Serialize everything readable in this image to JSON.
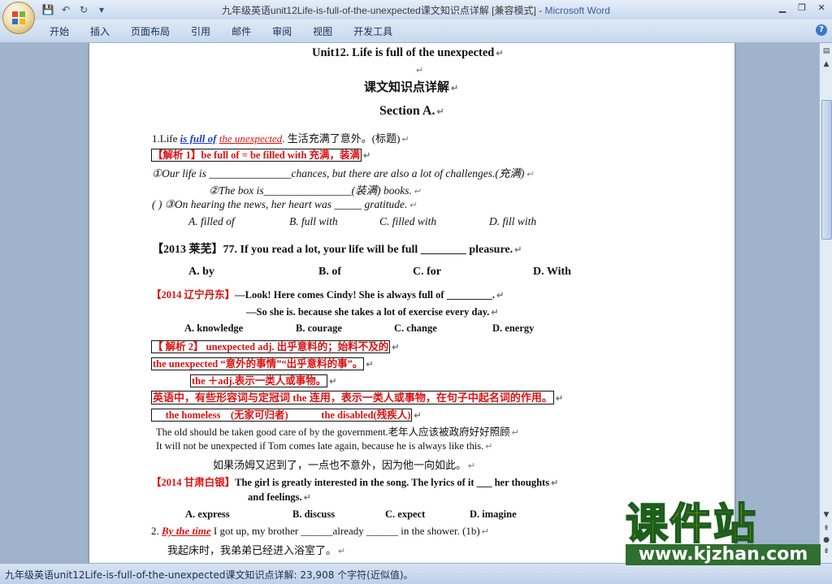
{
  "window": {
    "title_doc": "九年级英语unit12Life-is-full-of-the-unexpected课文知识点详解 [兼容模式] - ",
    "title_app": "Microsoft Word"
  },
  "tabs": [
    "开始",
    "插入",
    "页面布局",
    "引用",
    "邮件",
    "审阅",
    "视图",
    "开发工具"
  ],
  "icons": {
    "save": "save-icon",
    "undo": "undo-icon",
    "redo": "redo-icon",
    "customize": "dropdown-icon",
    "minimize": "minimize-icon",
    "maximize": "maximize-icon",
    "close": "close-icon",
    "help": "help-icon"
  },
  "doc": {
    "l01": "Unit12. Life is full of the unexpected",
    "l02": "课文知识点详解",
    "l03": "Section A.",
    "l04": {
      "pre": "1.Life ",
      "a": "is full of",
      "b": "the unexpected",
      "post": ". 生活充满了意外。(标题)"
    },
    "l05": "【解析 1】be full of = be filled with 充满，装满",
    "l06": "①Our life is _______________chances, but there are also a lot of challenges.(充满)",
    "l07": "②The box is________________(装满) books.",
    "l08": "(       )  ③On hearing the news, her heart was _____ gratitude.",
    "l09": [
      "A. filled  of",
      "B. full with",
      "C. filled    with",
      "D. fill with"
    ],
    "l10": "【2013 莱芜】77. If you read a lot, your life will be full ________ pleasure.",
    "l11": [
      "A. by",
      "B. of",
      "C. for",
      "D. With"
    ],
    "l12": {
      "tag": "【2014 辽宁丹东】",
      "text": "—Look! Here comes Cindy! She is always full of  _________."
    },
    "l13": "—So she is. because she takes a lot of exercise every day.",
    "l14": [
      "A. knowledge",
      "B. courage",
      "C. change",
      "D. energy"
    ],
    "l15": "【 解析 2】   unexpected    adj. 出乎意料的；始料不及的",
    "l16": "the unexpected    “意外的事情”“出乎意料的事”。",
    "l17": "the  ＋adj.表示一类人或事物。",
    "l18": "英语中，有些形容词与定冠词 the 连用，表示一类人或事物，在句子中起名词的作用。",
    "l19": "     the homeless    (无家可归者)             the disabled(残疾人)",
    "l20": "The old should be taken good care of by the government.老年人应该被政府好好照顾",
    "l21": "It will not be unexpected if Tom comes late again, because he is always like this.",
    "l22": "如果汤姆又迟到了，一点也不意外，因为他一向如此。",
    "l23": {
      "tag": "【2014 甘肃白银】",
      "text": "The girl is greatly interested in the song. The lyrics of it ___ her thoughts"
    },
    "l24": "and feelings.",
    "l25": [
      "A. express",
      "B. discuss",
      "C. expect",
      "D. imagine"
    ],
    "l26": {
      "pre": "2. ",
      "a": "By the time",
      "post": " I got up, my brother ______already ______ in the shower. (1b)"
    },
    "l27": "我起床时，我弟弟已经进入浴室了。"
  },
  "status": "九年级英语unit12Life-is-full-of-the-unexpected课文知识点详解: 23,908 个字符(近似值)。",
  "watermark": {
    "big": "课件站",
    "url": "www.kjzhan.com"
  }
}
